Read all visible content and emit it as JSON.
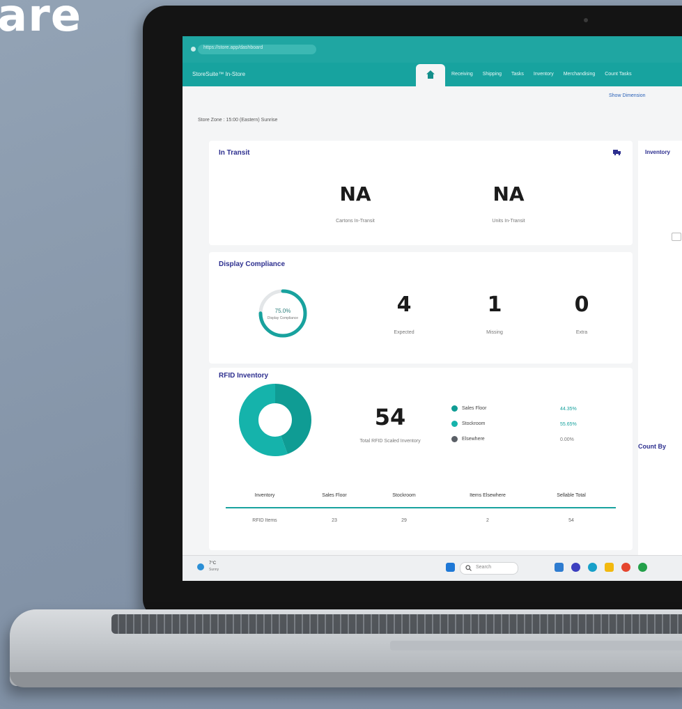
{
  "headline": "are",
  "browser": {
    "url": "https://store.app/dashboard"
  },
  "app": {
    "name": "StoreSuite™ In-Store",
    "nav": [
      "Receiving",
      "Shipping",
      "Tasks",
      "Inventory",
      "Merchandising",
      "Count Tasks"
    ],
    "show_button": "Show Dimension",
    "store_info": "Store Zone : 15:00 (Eastern) Sunrise"
  },
  "in_transit": {
    "title": "In Transit",
    "cartons_value": "NA",
    "cartons_label": "Cartons In-Transit",
    "units_value": "NA",
    "units_label": "Units In-Transit"
  },
  "inventory_card": {
    "title": "Inventory"
  },
  "display_compliance": {
    "title": "Display Compliance",
    "gauge_pct": "75.0%",
    "gauge_label": "Display Compliance",
    "gauge_fraction": 0.75,
    "stats": [
      {
        "value": "4",
        "label": "Expected"
      },
      {
        "value": "1",
        "label": "Missing"
      },
      {
        "value": "0",
        "label": "Extra"
      }
    ]
  },
  "rfid_inventory": {
    "title": "RFID Inventory",
    "total": "54",
    "total_label": "Total RFID Scaled Inventory",
    "legend": [
      {
        "label": "Sales Floor",
        "pct": "44.35%",
        "color": "#0f9c94"
      },
      {
        "label": "Stockroom",
        "pct": "55.65%",
        "color": "#15b3ab"
      },
      {
        "label": "Elsewhere",
        "pct": "0.00%",
        "color": "#5a5f66"
      }
    ],
    "donut_fractions": [
      0.4435,
      0.5565
    ],
    "table": {
      "headers": [
        "Inventory",
        "Sales Floor",
        "Stockroom",
        "Items Elsewhere",
        "Sellable Total"
      ],
      "rows": [
        [
          "RFID Items",
          "23",
          "29",
          "2",
          "54"
        ]
      ]
    }
  },
  "count_card": {
    "title": "Count By"
  },
  "taskbar": {
    "weather_temp": "7°C",
    "weather_desc": "Sunny",
    "search_placeholder": "Search"
  }
}
